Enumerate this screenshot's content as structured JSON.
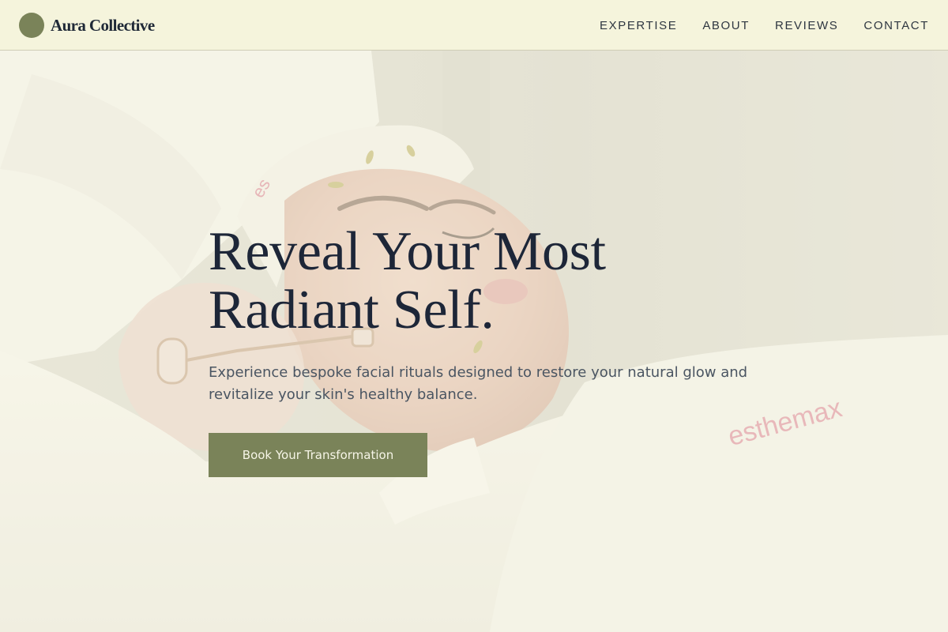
{
  "brand": {
    "name": "Aura Collective",
    "mark_color": "#7a8359"
  },
  "nav": {
    "items": [
      {
        "label": "EXPERTISE"
      },
      {
        "label": "ABOUT"
      },
      {
        "label": "REVIEWS"
      },
      {
        "label": "CONTACT"
      }
    ]
  },
  "hero": {
    "title_line1": "Reveal Your Most",
    "title_line2": "Radiant Self.",
    "subtitle": "Experience bespoke facial rituals designed to restore your natural glow and revitalize your skin's healthy balance.",
    "cta_label": "Book Your Transformation",
    "background_image": "woman receiving facial massage with rose quartz roller",
    "towel_print": "esthemax"
  },
  "colors": {
    "header_bg": "#f5f4dc",
    "accent": "#7a8359",
    "heading": "#1d2638",
    "body_text": "#4a5562"
  }
}
